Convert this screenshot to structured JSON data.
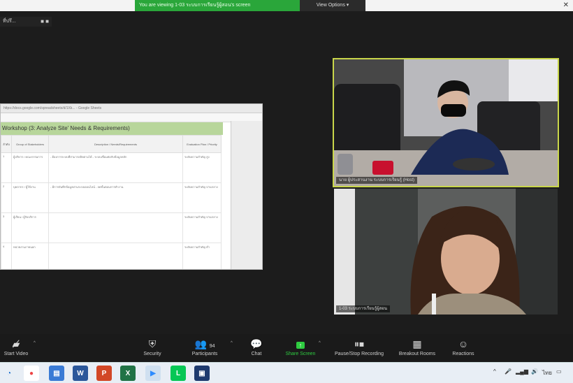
{
  "top_banner": {
    "message": "You are viewing 1-03 ระบบการเรียนรู้ผู้สอน's screen",
    "view_options": "View Options ▾"
  },
  "mini_window": {
    "label": "ที่ปรึ..."
  },
  "shared_screen": {
    "address": "https://docs.google.com/spreadsheets/d/1Xk... - Google Sheets",
    "sheet_title": "Workshop (3: Analyze Site' Needs & Requirements)",
    "columns": [
      "ลำดับ",
      "Group of Stakeholders",
      "Description / Needs/Requirements",
      "Evaluation Plan / Priority"
    ],
    "rows": [
      [
        "1",
        "ผู้บริหาร / คณะกรรมการ",
        "- ต้องการระบบที่สามารถติดตามได้\n- ระบบเชื่อมต่อกับข้อมูลหลัก",
        "ระดับความสำคัญ\nสูง"
      ],
      [
        "2",
        "บุคลากร / ผู้ใช้งาน",
        "- มีการบันทึกข้อมูลผ่านระบบออนไลน์\n- ลดขั้นตอนการทำงาน",
        "ระดับความสำคัญ\nปานกลาง"
      ],
      [
        "3",
        "ผู้เรียน / ผู้รับบริการ",
        "",
        "ระดับความสำคัญ\nปานกลาง"
      ],
      [
        "4",
        "หน่วยงานภายนอก",
        "",
        "ระดับความสำคัญ\nต่ำ"
      ]
    ]
  },
  "participants": [
    {
      "name": "นาย ผู้ประสานงาน ระบบการเรียนรู้ (Host)"
    },
    {
      "name": "1-03 ระบบการเรียนรู้ผู้สอน"
    }
  ],
  "toolbar": {
    "unmute": "Start Video",
    "security": "Security",
    "participants": "Participants",
    "participants_count": "94",
    "chat": "Chat",
    "share_screen": "Share Screen",
    "pause_share": "Pause/Stop Recording",
    "breakout": "Breakout Rooms",
    "reactions": "Reactions"
  },
  "tray": {
    "language": "ไทย"
  },
  "colors": {
    "zoom_green": "#2ecc40",
    "active_speaker": "#c9d64a",
    "sheet_header_green": "#b8d69b"
  }
}
